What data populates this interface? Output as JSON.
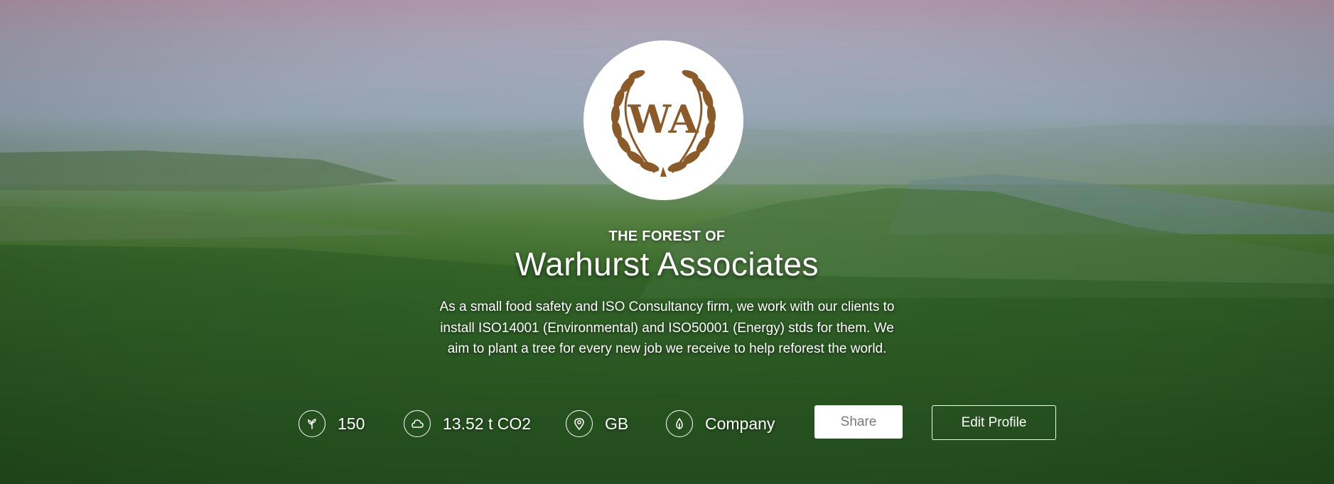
{
  "profile": {
    "eyebrow": "THE FOREST OF",
    "name": "Warhurst Associates",
    "description": "As a small food safety and ISO Consultancy firm, we work with our clients to install ISO14001 (Environmental) and ISO50001 (Energy) stds for them. We aim to plant a tree for every new job we receive to help reforest the world.",
    "logo_text": "WA",
    "logo_color": "#8b5a2b"
  },
  "stats": [
    {
      "icon": "sapling-icon",
      "value": "150"
    },
    {
      "icon": "cloud-icon",
      "value": "13.52 t CO2"
    },
    {
      "icon": "map-pin-icon",
      "value": "GB"
    },
    {
      "icon": "company-icon",
      "value": "Company"
    }
  ],
  "actions": {
    "share_label": "Share",
    "edit_label": "Edit Profile"
  }
}
